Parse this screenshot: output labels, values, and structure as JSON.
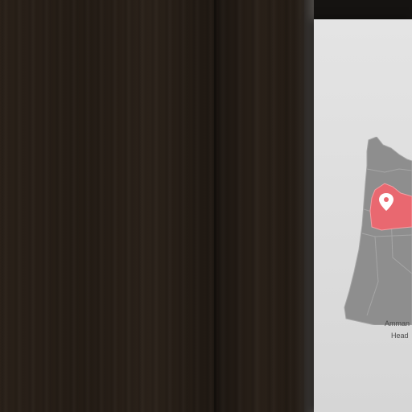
{
  "poster": {
    "caption_line_1": "Amman",
    "caption_line_2": "Head"
  },
  "colors": {
    "map_fill": "#8e8e8e",
    "region_highlight": "#e96870",
    "pin": "#ffffff",
    "poster_bg": "#e0e0e0"
  },
  "icons": [
    "location-pin-icon"
  ]
}
